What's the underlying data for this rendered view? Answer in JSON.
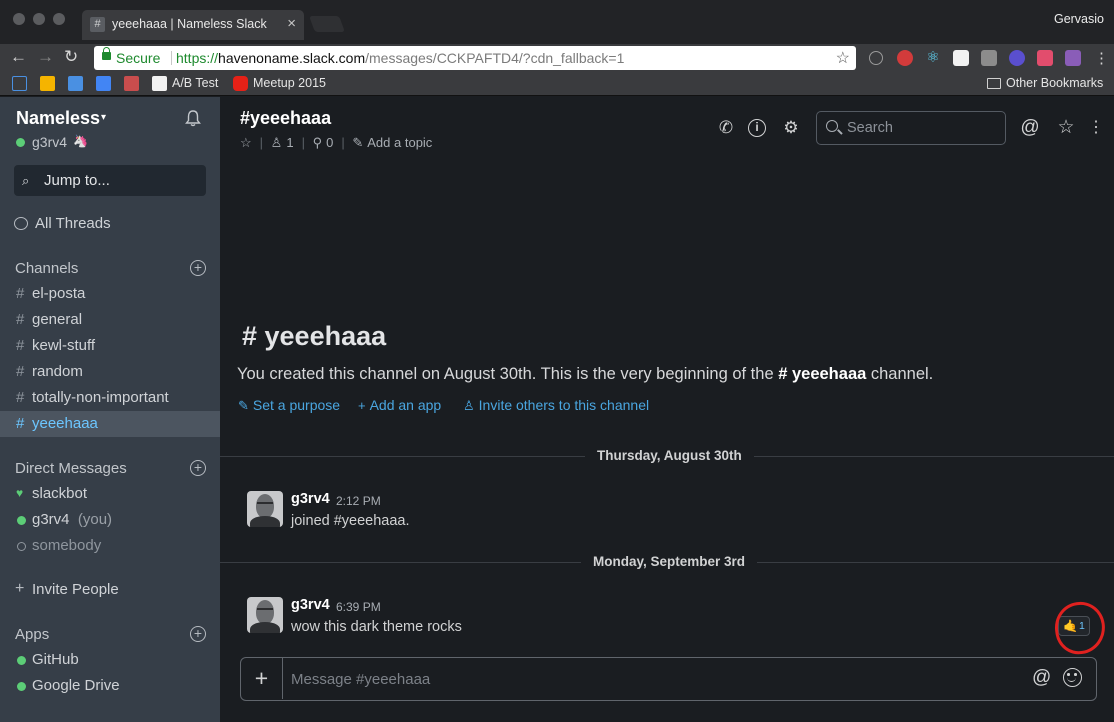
{
  "browser": {
    "tab_title": "yeeehaaa | Nameless Slack",
    "profile_name": "Gervasio",
    "secure_label": "Secure",
    "url_scheme": "https://",
    "url_host": "havenoname.slack.com",
    "url_path": "/messages/CCKPAFTD4/?cdn_fallback=1"
  },
  "bookmarks": [
    {
      "label": "A/B Test"
    },
    {
      "label": "Meetup 2015"
    }
  ],
  "bookmarks_other": "Other Bookmarks",
  "sidebar": {
    "team_name": "Nameless",
    "user_name": "g3rv4",
    "jump_to": "Jump to...",
    "all_threads": "All Threads",
    "channels_heading": "Channels",
    "channels": [
      {
        "name": "el-posta",
        "active": false
      },
      {
        "name": "general",
        "active": false
      },
      {
        "name": "kewl-stuff",
        "active": false
      },
      {
        "name": "random",
        "active": false
      },
      {
        "name": "totally-non-important",
        "active": false
      },
      {
        "name": "yeeehaaa",
        "active": true
      }
    ],
    "dm_heading": "Direct Messages",
    "dms": [
      {
        "name": "slackbot",
        "status": "heart"
      },
      {
        "name": "g3rv4",
        "suffix": "(you)",
        "status": "online"
      },
      {
        "name": "somebody",
        "status": "away"
      }
    ],
    "invite_people": "Invite People",
    "apps_heading": "Apps",
    "apps": [
      {
        "name": "GitHub"
      },
      {
        "name": "Google Drive"
      }
    ]
  },
  "channel": {
    "title": "#yeeehaaa",
    "members_count": "1",
    "pins_count": "0",
    "add_topic": "Add a topic",
    "search_placeholder": "Search"
  },
  "intro": {
    "title": "# yeeehaaa",
    "text_before": "You created this channel on August 30th. This is the very beginning of the ",
    "text_channel": "# yeeehaaa",
    "text_after": " channel.",
    "set_purpose": "Set a purpose",
    "add_app": "Add an app",
    "invite_others": "Invite others to this channel"
  },
  "messages": [
    {
      "day": "Thursday, August 30th",
      "author": "g3rv4",
      "time": "2:12 PM",
      "text": "joined #yeeehaaa."
    },
    {
      "day": "Monday, September 3rd",
      "author": "g3rv4",
      "time": "6:39 PM",
      "text": "wow this dark theme rocks",
      "reaction_emoji": "🤙",
      "reaction_count": "1"
    }
  ],
  "composer": {
    "placeholder": "Message #yeeehaaa"
  },
  "colors": {
    "sidebar_bg": "#363e48",
    "main_bg": "#1a1d21",
    "online": "#5ccd77",
    "link": "#4aa6e0",
    "active_channel": "#6cc6ff",
    "annotation": "#e0211f"
  }
}
